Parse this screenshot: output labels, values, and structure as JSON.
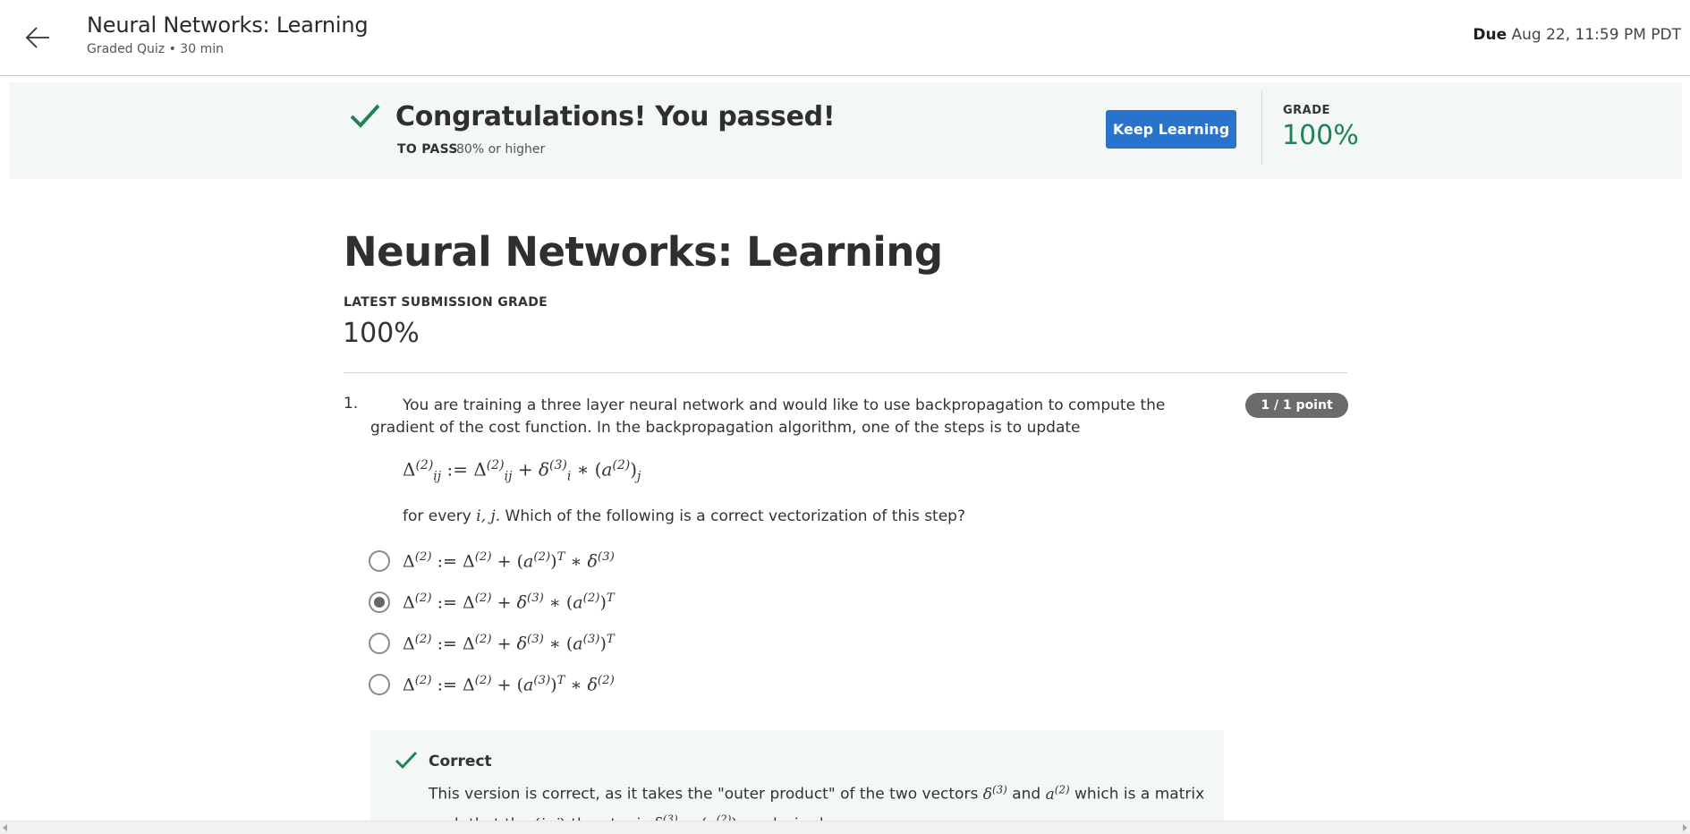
{
  "header": {
    "course_title": "Neural Networks: Learning",
    "subtitle": "Graded Quiz • 30 min",
    "due_label": "Due",
    "due_value": "Aug 22, 11:59 PM PDT"
  },
  "banner": {
    "title": "Congratulations! You passed!",
    "to_pass_label": "TO PASS",
    "to_pass_value": "80% or higher",
    "button_label": "Keep Learning",
    "grade_label": "GRADE",
    "grade_value": "100%",
    "grade_color": "#1f8354",
    "button_color": "#2a73cc"
  },
  "main": {
    "title": "Neural Networks: Learning",
    "latest_label": "LATEST SUBMISSION GRADE",
    "latest_value": "100%"
  },
  "question": {
    "number": "1.",
    "text": "You are training a three layer neural network and would like to use backpropagation to compute the gradient of the cost function.  In the backpropagation algorithm, one of the steps is to update",
    "points": "1 / 1 point",
    "for_every_prefix": "for every",
    "for_every_vars": "i, j.",
    "for_every_suffix": "Which of the following is a correct vectorization of this step?",
    "selected_option": 2
  },
  "feedback": {
    "title": "Correct",
    "text_1": "This version is correct, as it takes the \"outer product\" of the two vectors",
    "text_and": "and",
    "text_2": "which is a matrix such that the",
    "text_3": "-th entry is",
    "text_4": "as desired."
  }
}
